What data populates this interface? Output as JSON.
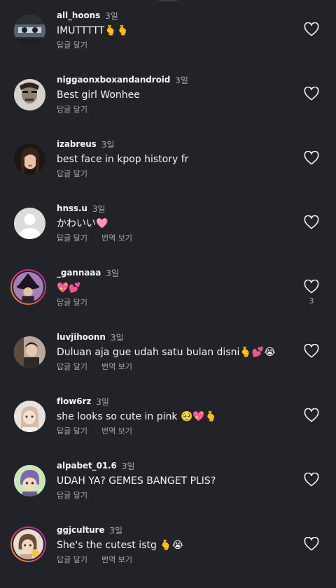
{
  "strings": {
    "reply": "답글 달기",
    "translate": "번역 보기"
  },
  "colors": {
    "background": "#212328",
    "text_primary": "#f5f5f5",
    "text_secondary": "#a8a8a8",
    "story_ring": [
      "#f9a22a",
      "#e1306c",
      "#a22fd6"
    ]
  },
  "icons": {
    "like": "heart-outline-icon"
  },
  "comments": [
    {
      "username": "all_hoons",
      "time": "3일",
      "text": "IMUTTTTT🫰🫰",
      "show_translate": false,
      "likes": "",
      "story_ring": false
    },
    {
      "username": "niggaonxboxandandroid",
      "time": "3일",
      "text": "Best girl Wonhee",
      "show_translate": false,
      "likes": "",
      "story_ring": false
    },
    {
      "username": "izabreus",
      "time": "3일",
      "text": "best face in kpop history fr",
      "show_translate": false,
      "likes": "",
      "story_ring": false
    },
    {
      "username": "hnss.u",
      "time": "3일",
      "text": "かわいい🩷",
      "show_translate": true,
      "likes": "",
      "story_ring": false
    },
    {
      "username": "_gannaaa",
      "time": "3일",
      "text": "💖💕",
      "show_translate": false,
      "likes": "3",
      "story_ring": true
    },
    {
      "username": "luvjihoonn",
      "time": "3일",
      "text": "Duluan aja gue udah satu bulan disni🫰💕😭",
      "show_translate": true,
      "likes": "",
      "story_ring": false
    },
    {
      "username": "flow6rz",
      "time": "3일",
      "text": "she looks so cute in pink 🥺💖🫰",
      "show_translate": true,
      "likes": "",
      "story_ring": false
    },
    {
      "username": "alpabet_01.6",
      "time": "3일",
      "text": "UDAH YA? GEMES BANGET PLIS?",
      "show_translate": false,
      "likes": "",
      "story_ring": false
    },
    {
      "username": "ggjculture",
      "time": "3일",
      "text": "She's the cutest istg 🫰😭",
      "show_translate": true,
      "likes": "",
      "story_ring": true
    }
  ]
}
